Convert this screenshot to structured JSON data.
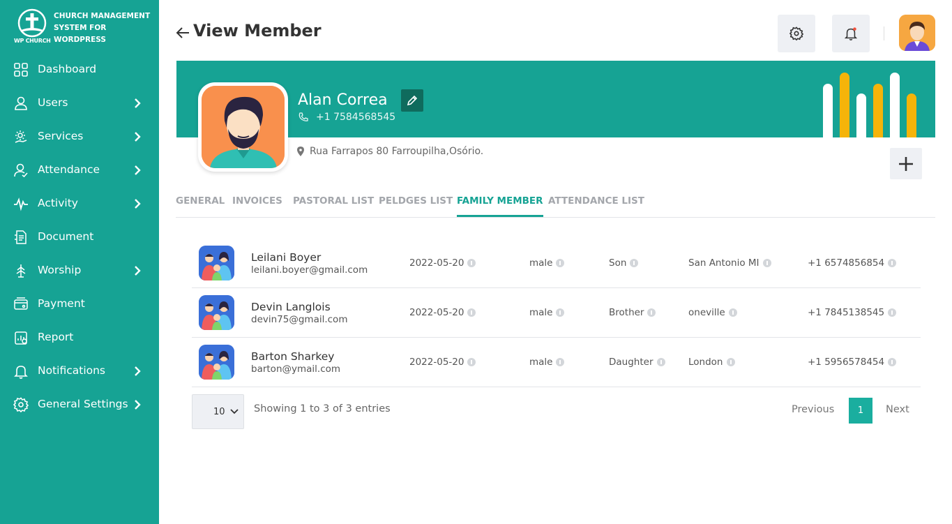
{
  "brand": {
    "logo_text": "WP CHURCH",
    "title": "CHURCH MANAGEMENT SYSTEM FOR WORDPRESS"
  },
  "sidebar": {
    "items": [
      {
        "label": "Dashboard",
        "icon": "dashboard-icon",
        "has_submenu": false
      },
      {
        "label": "Users",
        "icon": "user-icon",
        "has_submenu": true
      },
      {
        "label": "Services",
        "icon": "services-icon",
        "has_submenu": true
      },
      {
        "label": "Attendance",
        "icon": "attendance-icon",
        "has_submenu": true
      },
      {
        "label": "Activity",
        "icon": "activity-icon",
        "has_submenu": true
      },
      {
        "label": "Document",
        "icon": "document-icon",
        "has_submenu": false
      },
      {
        "label": "Worship",
        "icon": "worship-icon",
        "has_submenu": true
      },
      {
        "label": "Payment",
        "icon": "payment-icon",
        "has_submenu": false
      },
      {
        "label": "Report",
        "icon": "report-icon",
        "has_submenu": false
      },
      {
        "label": "Notifications",
        "icon": "bell-icon",
        "has_submenu": true
      },
      {
        "label": "General Settings",
        "icon": "gear-icon",
        "has_submenu": true
      }
    ]
  },
  "header": {
    "title": "View Member"
  },
  "member": {
    "name": "Alan Correa",
    "phone": "+1 7584568545",
    "address": "Rua Farrapos 80 Farroupilha,Osório."
  },
  "tabs": [
    {
      "label": "GENERAL",
      "active": false
    },
    {
      "label": "INVOICES",
      "active": false
    },
    {
      "label": "PASTORAL LIST",
      "active": false
    },
    {
      "label": "PELDGES LIST",
      "active": false
    },
    {
      "label": "FAMILY MEMBER",
      "active": true
    },
    {
      "label": "ATTENDANCE LIST",
      "active": false
    }
  ],
  "family_members": [
    {
      "name": "Leilani Boyer",
      "email": "leilani.boyer@gmail.com",
      "date": "2022-05-20",
      "gender": "male",
      "relation": "Son",
      "city": "San Antonio MI",
      "phone": "+1 6574856854"
    },
    {
      "name": "Devin Langlois",
      "email": "devin75@gmail.com",
      "date": "2022-05-20",
      "gender": "male",
      "relation": "Brother",
      "city": "oneville",
      "phone": "+1 7845138545"
    },
    {
      "name": "Barton Sharkey",
      "email": "barton@ymail.com",
      "date": "2022-05-20",
      "gender": "male",
      "relation": "Daughter",
      "city": "London",
      "phone": "+1 5956578454"
    }
  ],
  "pagination": {
    "page_size": "10",
    "showing": "Showing 1 to 3 of 3 entries",
    "previous": "Previous",
    "current": "1",
    "next": "Next"
  },
  "colors": {
    "primary": "#16a394",
    "dark_accent": "#0f6b5d",
    "bar_yellow": "#f5b40a"
  }
}
